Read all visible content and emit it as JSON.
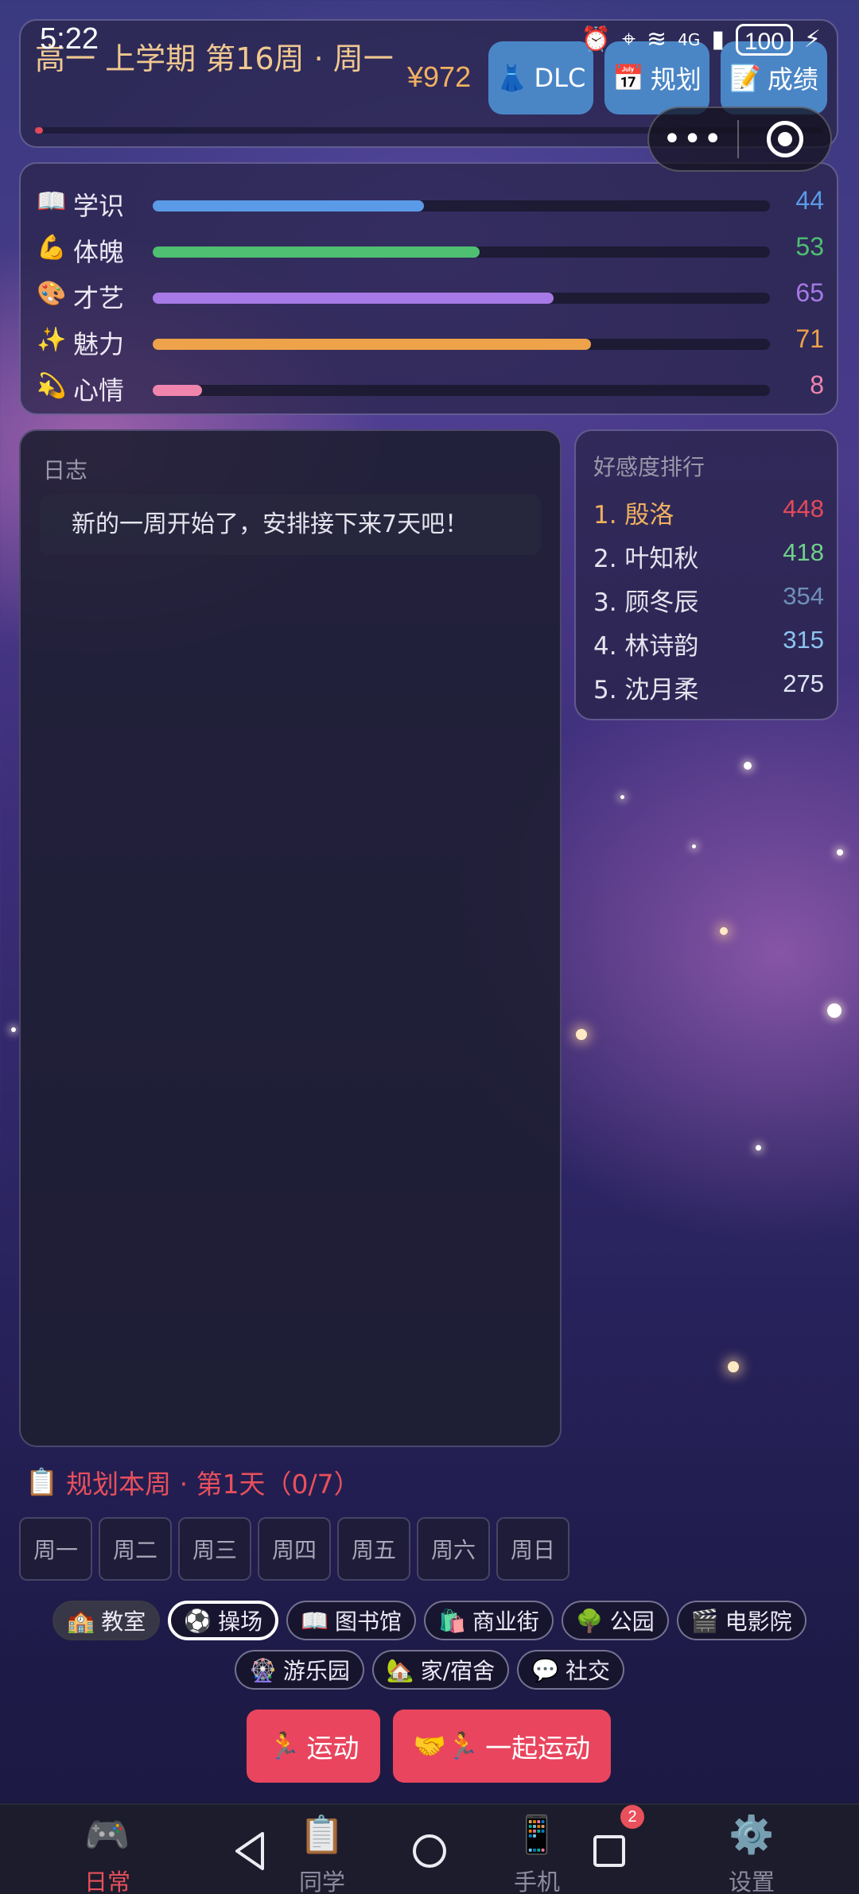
{
  "status_bar": {
    "time": "5:22",
    "network": "4G",
    "battery": "100"
  },
  "header": {
    "term": "高一 上学期 第16周 · 周一",
    "money": "¥972",
    "week_progress": 0.01,
    "buttons": [
      {
        "icon": "👗",
        "label": "DLC"
      },
      {
        "icon": "📅",
        "label": "规划"
      },
      {
        "icon": "📝",
        "label": "成绩"
      }
    ],
    "capsule": {
      "menu": "•••"
    }
  },
  "stats": [
    {
      "icon": "📖",
      "label": "学识",
      "value": 44,
      "ratio": 0.44,
      "color": "#5b9ae6",
      "value_color": "#5b9ae6"
    },
    {
      "icon": "💪",
      "label": "体魄",
      "value": 53,
      "ratio": 0.53,
      "color": "#4fbf72",
      "value_color": "#4fbf72"
    },
    {
      "icon": "🎨",
      "label": "才艺",
      "value": 65,
      "ratio": 0.65,
      "color": "#a679e6",
      "value_color": "#a679e6"
    },
    {
      "icon": "✨",
      "label": "魅力",
      "value": 71,
      "ratio": 0.71,
      "color": "#eea24a",
      "value_color": "#eea24a"
    },
    {
      "icon": "💫",
      "label": "心情",
      "value": 8,
      "ratio": 0.08,
      "color": "#ef85ad",
      "value_color": "#ef85ad"
    }
  ],
  "log": {
    "title": "日志",
    "entries": [
      "新的一周开始了，安排接下来7天吧！"
    ]
  },
  "ranking": {
    "title": "好感度排行",
    "items": [
      {
        "name": "1. 殷洛",
        "score": "448",
        "color": "#e34a5a",
        "name_color": "#f0b060"
      },
      {
        "name": "2. 叶知秋",
        "score": "418",
        "color": "#6fd08a",
        "name_color": "#e6e4ee"
      },
      {
        "name": "3. 顾冬辰",
        "score": "354",
        "color": "#6f8fb8",
        "name_color": "#e6e4ee"
      },
      {
        "name": "4. 林诗韵",
        "score": "315",
        "color": "#8cc4f0",
        "name_color": "#e6e4ee"
      },
      {
        "name": "5. 沈月柔",
        "score": "275",
        "color": "#e0e6f4",
        "name_color": "#e6e4ee"
      }
    ]
  },
  "plan": {
    "icon": "📋",
    "title": "规划本周 · 第1天（0/7）",
    "days": [
      "周一",
      "周二",
      "周三",
      "周四",
      "周五",
      "周六",
      "周日"
    ]
  },
  "places_row1": [
    {
      "icon": "🏫",
      "label": "教室"
    },
    {
      "icon": "⚽",
      "label": "操场"
    },
    {
      "icon": "📖",
      "label": "图书馆"
    },
    {
      "icon": "🛍️",
      "label": "商业街"
    },
    {
      "icon": "🌳",
      "label": "公园"
    },
    {
      "icon": "🎬",
      "label": "电影院"
    }
  ],
  "places_row2": [
    {
      "icon": "🎡",
      "label": "游乐园"
    },
    {
      "icon": "🏡",
      "label": "家/宿舍"
    },
    {
      "icon": "💬",
      "label": "社交"
    }
  ],
  "actions": [
    {
      "icon": "🏃",
      "label": "运动"
    },
    {
      "icon": "🤝🏃",
      "label": "一起运动"
    }
  ],
  "bottom_nav": [
    {
      "icon": "🎮",
      "label": "日常"
    },
    {
      "icon": "📋",
      "label": "同学"
    },
    {
      "icon": "📱",
      "label": "手机"
    },
    {
      "icon": "⚙️",
      "label": "设置"
    }
  ],
  "system_nav": {
    "recents_badge": "2"
  }
}
